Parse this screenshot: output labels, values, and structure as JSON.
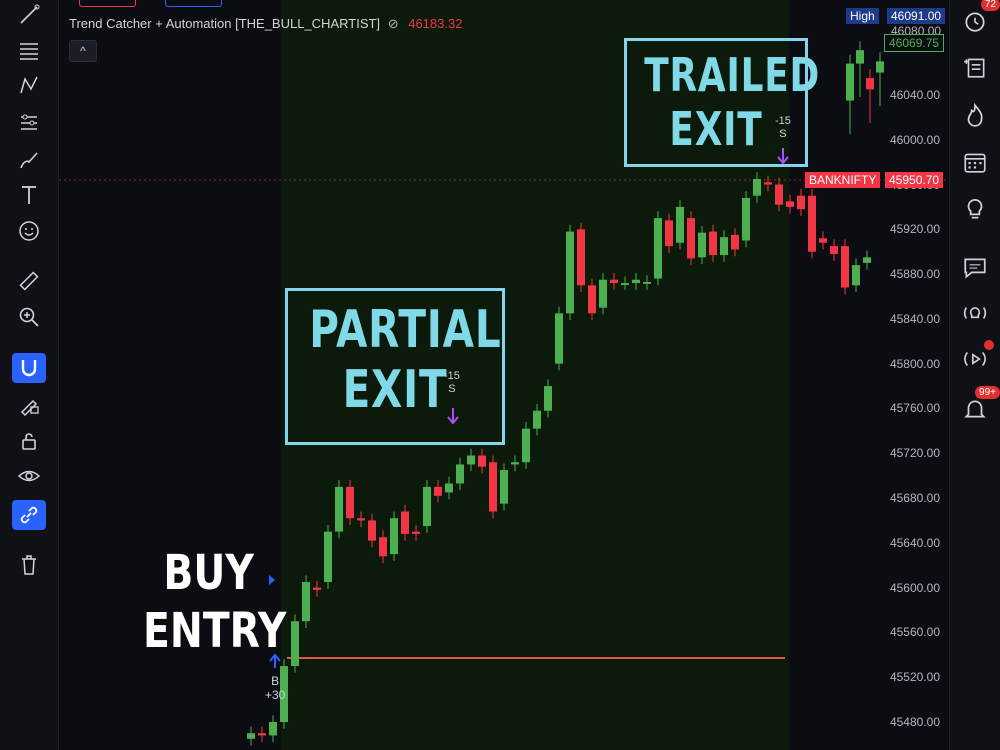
{
  "legend": {
    "title": "Trend Catcher + Automation [THE_BULL_CHARTIST]",
    "symbol": "⊘",
    "price": "46183.32",
    "collapse": "^"
  },
  "left_tools": [
    "line-tool-icon",
    "fib-icon",
    "pattern-icon",
    "prediction-icon",
    "brush-icon",
    "text-icon",
    "emoji-icon",
    "ruler-icon",
    "zoom-in-icon",
    "magnet-icon",
    "lock-drawing-icon",
    "lock-icon",
    "eye-icon",
    "link-icon",
    "trash-icon"
  ],
  "right_tools": {
    "alerts_badge": "72",
    "notifications_badge": "99+"
  },
  "annotations": {
    "buy_entry_line1": "BUY",
    "buy_entry_line2": "ENTRY",
    "partial_exit_line1": "PARTIAL",
    "partial_exit_line2": "EXIT",
    "trailed_exit_line1": "TRAILED",
    "trailed_exit_line2": "EXIT"
  },
  "markers": {
    "buy_label": "B",
    "buy_qty": "+30",
    "partial_qty": "-15",
    "partial_side": "S",
    "trail_qty": "-15",
    "trail_side": "S"
  },
  "price_tags": {
    "high_label": "High",
    "high_value": "46091.00",
    "top_value": "46080.00",
    "last_value": "46069.75",
    "symbol_label": "BANKNIFTY",
    "symbol_value": "45950.70"
  },
  "colors": {
    "up": "#4caf50",
    "down": "#f23645",
    "highlight_zone": "#0c1a0c",
    "entry_line": "#e05a45",
    "partial_box": "#7fd9e6",
    "trailed_box": "#7fd9e6"
  },
  "chart_data": {
    "type": "candlestick",
    "y_ticks": [
      "46040.00",
      "46000.00",
      "45960.00",
      "45920.00",
      "45880.00",
      "45840.00",
      "45800.00",
      "45760.00",
      "45720.00",
      "45680.00",
      "45640.00",
      "45600.00",
      "45560.00",
      "45520.00",
      "45480.00"
    ],
    "ylim": [
      45460,
      46100
    ],
    "entry_price": 45545,
    "candles": [
      {
        "o": 45465,
        "c": 45470
      },
      {
        "o": 45470,
        "c": 45468
      },
      {
        "o": 45468,
        "c": 45480
      },
      {
        "o": 45480,
        "c": 45530
      },
      {
        "o": 45530,
        "c": 45570
      },
      {
        "o": 45570,
        "c": 45605
      },
      {
        "o": 45600,
        "c": 45598
      },
      {
        "o": 45605,
        "c": 45650
      },
      {
        "o": 45650,
        "c": 45690
      },
      {
        "o": 45690,
        "c": 45662
      },
      {
        "o": 45662,
        "c": 45660
      },
      {
        "o": 45660,
        "c": 45642
      },
      {
        "o": 45645,
        "c": 45628
      },
      {
        "o": 45630,
        "c": 45662
      },
      {
        "o": 45668,
        "c": 45648
      },
      {
        "o": 45650,
        "c": 45648
      },
      {
        "o": 45655,
        "c": 45690
      },
      {
        "o": 45690,
        "c": 45682
      },
      {
        "o": 45685,
        "c": 45693
      },
      {
        "o": 45693,
        "c": 45710
      },
      {
        "o": 45710,
        "c": 45718
      },
      {
        "o": 45718,
        "c": 45708
      },
      {
        "o": 45712,
        "c": 45668
      },
      {
        "o": 45675,
        "c": 45705
      },
      {
        "o": 45710,
        "c": 45712
      },
      {
        "o": 45712,
        "c": 45742
      },
      {
        "o": 45742,
        "c": 45758
      },
      {
        "o": 45758,
        "c": 45780
      },
      {
        "o": 45800,
        "c": 45845
      },
      {
        "o": 45845,
        "c": 45918
      },
      {
        "o": 45920,
        "c": 45870
      },
      {
        "o": 45870,
        "c": 45845
      },
      {
        "o": 45850,
        "c": 45875
      },
      {
        "o": 45875,
        "c": 45872
      },
      {
        "o": 45872,
        "c": 45872
      },
      {
        "o": 45872,
        "c": 45875
      },
      {
        "o": 45872,
        "c": 45873
      },
      {
        "o": 45876,
        "c": 45930
      },
      {
        "o": 45928,
        "c": 45905
      },
      {
        "o": 45908,
        "c": 45940
      },
      {
        "o": 45930,
        "c": 45894
      },
      {
        "o": 45895,
        "c": 45917
      },
      {
        "o": 45918,
        "c": 45897
      },
      {
        "o": 45897,
        "c": 45913
      },
      {
        "o": 45915,
        "c": 45902
      },
      {
        "o": 45910,
        "c": 45948
      },
      {
        "o": 45950,
        "c": 45965
      },
      {
        "o": 45962,
        "c": 45960
      },
      {
        "o": 45960,
        "c": 45942
      },
      {
        "o": 45945,
        "c": 45940
      },
      {
        "o": 45950,
        "c": 45938
      },
      {
        "o": 45950,
        "c": 45900
      },
      {
        "o": 45912,
        "c": 45908
      },
      {
        "o": 45905,
        "c": 45898
      },
      {
        "o": 45905,
        "c": 45868
      },
      {
        "o": 45870,
        "c": 45888
      },
      {
        "o": 45890,
        "c": 45895
      }
    ],
    "candles_right": [
      {
        "o": 46035,
        "c": 46068
      },
      {
        "o": 46068,
        "c": 46080
      },
      {
        "o": 46055,
        "c": 46045
      },
      {
        "o": 46060,
        "c": 46070
      }
    ]
  }
}
